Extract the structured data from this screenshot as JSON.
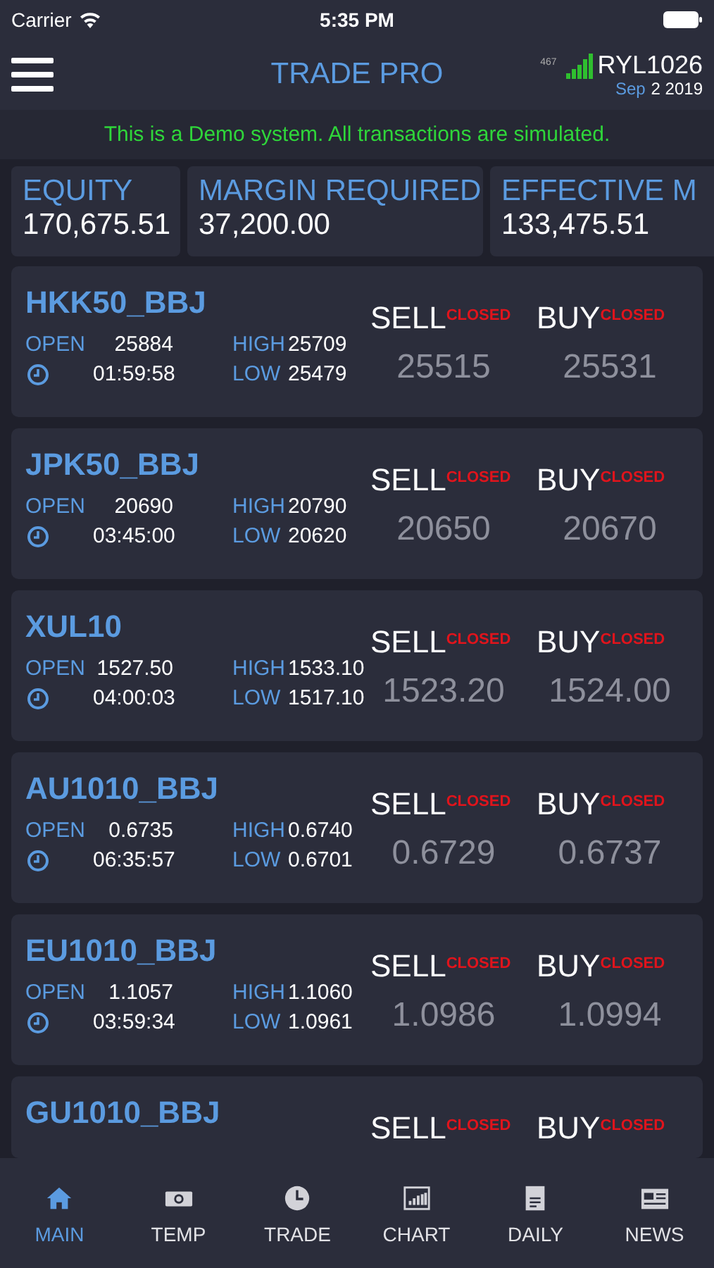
{
  "status_bar": {
    "carrier": "Carrier",
    "time": "5:35 PM"
  },
  "header": {
    "title": "TRADE PRO",
    "badge": "467",
    "account": "RYL1026",
    "month": "Sep",
    "day_year": "2 2019"
  },
  "banner": "This is a Demo system. All transactions are simulated.",
  "summary": [
    {
      "label": "EQUITY",
      "value": "170,675.51"
    },
    {
      "label": "MARGIN REQUIRED",
      "value": "37,200.00"
    },
    {
      "label": "EFFECTIVE M",
      "value": "133,475.51"
    }
  ],
  "quotes": [
    {
      "symbol": "HKK50_BBJ",
      "open_label": "OPEN",
      "open": "25884",
      "time": "01:59:58",
      "high_label": "HIGH",
      "high": "25709",
      "low_label": "LOW",
      "low": "25479",
      "sell_label": "SELL",
      "sell_status": "CLOSED",
      "buy_label": "BUY",
      "buy_status": "CLOSED",
      "sell": "25515",
      "buy": "25531"
    },
    {
      "symbol": "JPK50_BBJ",
      "open_label": "OPEN",
      "open": "20690",
      "time": "03:45:00",
      "high_label": "HIGH",
      "high": "20790",
      "low_label": "LOW",
      "low": "20620",
      "sell_label": "SELL",
      "sell_status": "CLOSED",
      "buy_label": "BUY",
      "buy_status": "CLOSED",
      "sell": "20650",
      "buy": "20670"
    },
    {
      "symbol": "XUL10",
      "open_label": "OPEN",
      "open": "1527.50",
      "time": "04:00:03",
      "high_label": "HIGH",
      "high": "1533.10",
      "low_label": "LOW",
      "low": "1517.10",
      "sell_label": "SELL",
      "sell_status": "CLOSED",
      "buy_label": "BUY",
      "buy_status": "CLOSED",
      "sell": "1523.20",
      "buy": "1524.00"
    },
    {
      "symbol": "AU1010_BBJ",
      "open_label": "OPEN",
      "open": "0.6735",
      "time": "06:35:57",
      "high_label": "HIGH",
      "high": "0.6740",
      "low_label": "LOW",
      "low": "0.6701",
      "sell_label": "SELL",
      "sell_status": "CLOSED",
      "buy_label": "BUY",
      "buy_status": "CLOSED",
      "sell": "0.6729",
      "buy": "0.6737"
    },
    {
      "symbol": "EU1010_BBJ",
      "open_label": "OPEN",
      "open": "1.1057",
      "time": "03:59:34",
      "high_label": "HIGH",
      "high": "1.1060",
      "low_label": "LOW",
      "low": "1.0961",
      "sell_label": "SELL",
      "sell_status": "CLOSED",
      "buy_label": "BUY",
      "buy_status": "CLOSED",
      "sell": "1.0986",
      "buy": "1.0994"
    },
    {
      "symbol": "GU1010_BBJ",
      "sell_label": "SELL",
      "sell_status": "CLOSED",
      "buy_label": "BUY",
      "buy_status": "CLOSED"
    }
  ],
  "tabs": [
    {
      "label": "MAIN",
      "kind": "home",
      "selected": true
    },
    {
      "label": "TEMP",
      "kind": "money",
      "selected": false
    },
    {
      "label": "TRADE",
      "kind": "clock",
      "selected": false
    },
    {
      "label": "CHART",
      "kind": "chart",
      "selected": false
    },
    {
      "label": "DAILY",
      "kind": "doc",
      "selected": false
    },
    {
      "label": "NEWS",
      "kind": "news",
      "selected": false
    }
  ]
}
